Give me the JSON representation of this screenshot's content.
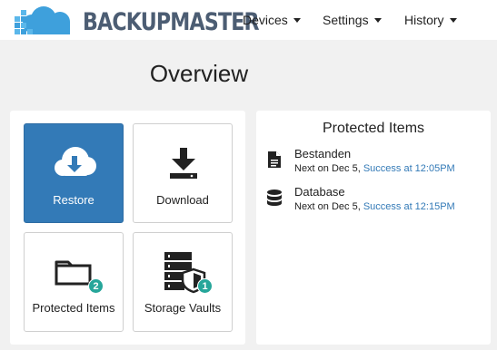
{
  "app": {
    "logo_text": "BACKUPMASTER",
    "brand_colors": {
      "cloud": "#3ea0dc",
      "text": "#4c5d73",
      "primary": "#337ab7",
      "badge": "#26a69a"
    }
  },
  "nav": {
    "items": [
      {
        "label": "Devices"
      },
      {
        "label": "Settings"
      },
      {
        "label": "History"
      }
    ]
  },
  "page": {
    "title": "Overview"
  },
  "tiles": [
    {
      "label": "Restore",
      "icon": "cloud-download-icon"
    },
    {
      "label": "Download",
      "icon": "download-icon"
    },
    {
      "label": "Protected Items",
      "icon": "folder-icon",
      "badge": "2"
    },
    {
      "label": "Storage Vaults",
      "icon": "server-shield-icon",
      "badge": "1"
    }
  ],
  "protected_items": {
    "title": "Protected Items",
    "items": [
      {
        "name": "Bestanden",
        "icon": "file-icon",
        "next": "Next on Dec 5,",
        "status": "Success at 12:05PM"
      },
      {
        "name": "Database",
        "icon": "database-icon",
        "next": "Next on Dec 5,",
        "status": "Success at 12:15PM"
      }
    ]
  }
}
